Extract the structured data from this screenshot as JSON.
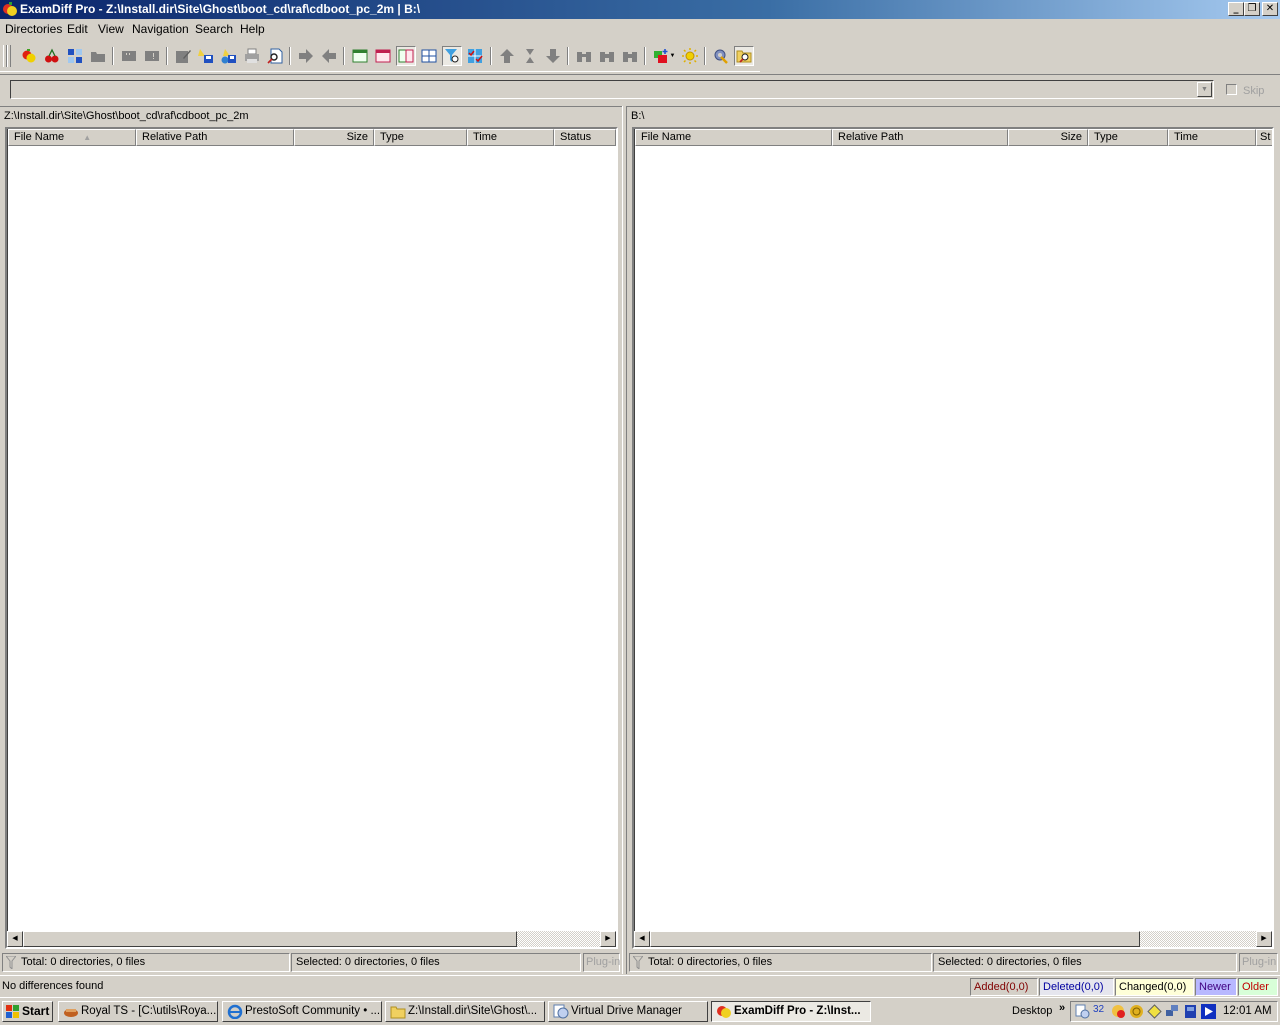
{
  "window": {
    "title": "ExamDiff Pro - Z:\\Install.dir\\Site\\Ghost\\boot_cd\\raf\\cdboot_pc_2m  |  B:\\",
    "controls": {
      "minimize": "_",
      "restore": "❐",
      "close": "✕"
    }
  },
  "menu": [
    "Directories",
    "Edit",
    "View",
    "Navigation",
    "Search",
    "Help"
  ],
  "toolbar": {
    "buttons": [
      {
        "name": "open-directories-icon"
      },
      {
        "name": "compare-cherries-icon"
      },
      {
        "name": "swap-panes-icon"
      },
      {
        "name": "open-folder-icon"
      },
      {
        "name": "comment-icon"
      },
      {
        "name": "alert-icon"
      },
      {
        "name": "edit-icon"
      },
      {
        "name": "save-left-icon"
      },
      {
        "name": "save-web-icon"
      },
      {
        "name": "print-icon"
      },
      {
        "name": "print-preview-icon"
      },
      {
        "name": "copy-right-arrow-icon"
      },
      {
        "name": "copy-left-arrow-icon"
      },
      {
        "name": "left-pane-only-icon"
      },
      {
        "name": "right-pane-only-icon"
      },
      {
        "name": "side-by-side-icon"
      },
      {
        "name": "grid-view-icon"
      },
      {
        "name": "filter-icon"
      },
      {
        "name": "checked-grid-icon"
      },
      {
        "name": "prev-diff-icon"
      },
      {
        "name": "current-diff-icon"
      },
      {
        "name": "next-diff-icon"
      },
      {
        "name": "find-icon"
      },
      {
        "name": "find-next-icon"
      },
      {
        "name": "find-prev-icon"
      },
      {
        "name": "add-plugin-icon"
      },
      {
        "name": "highlight-sun-icon"
      },
      {
        "name": "options-icon"
      },
      {
        "name": "browse-folder-icon"
      }
    ]
  },
  "filter": {
    "value": "",
    "skip_label": "Skip",
    "skip_checked": false
  },
  "left_pane": {
    "path": "Z:\\Install.dir\\Site\\Ghost\\boot_cd\\raf\\cdboot_pc_2m",
    "columns": [
      "File Name",
      "Relative Path",
      "Size",
      "Type",
      "Time",
      "Status"
    ],
    "sort_indicator": "▲",
    "rows": [],
    "status_total": "Total: 0 directories, 0 files",
    "status_selected": "Selected: 0 directories, 0 files",
    "plugin_label": "Plug-in"
  },
  "right_pane": {
    "path": "B:\\",
    "columns": [
      "File Name",
      "Relative Path",
      "Size",
      "Type",
      "Time",
      "St"
    ],
    "rows": [],
    "status_total": "Total: 0 directories, 0 files",
    "status_selected": "Selected: 0 directories, 0 files",
    "plugin_label": "Plug-in"
  },
  "status": {
    "message": "No differences found",
    "legend": [
      {
        "label": "Added(0,0)",
        "color": "#800000",
        "bg": "#d4d0c8"
      },
      {
        "label": "Deleted(0,0)",
        "color": "#0000a0",
        "bg": "#e6e6ee"
      },
      {
        "label": "Changed(0,0)",
        "color": "#000000",
        "bg": "#ffffd8"
      },
      {
        "label": "Newer",
        "color": "#400080",
        "bg": "#b8b8ff"
      },
      {
        "label": "Older",
        "color": "#c00000",
        "bg": "#d8ffd8"
      }
    ]
  },
  "taskbar": {
    "start_label": "Start",
    "tasks": [
      {
        "label": "Royal TS - [C:\\utils\\Roya...",
        "active": false
      },
      {
        "label": "PrestoSoft Community • ...",
        "active": false
      },
      {
        "label": "Z:\\Install.dir\\Site\\Ghost\\...",
        "active": false
      },
      {
        "label": "Virtual Drive Manager",
        "active": false
      },
      {
        "label": "ExamDiff Pro - Z:\\Inst...",
        "active": true
      }
    ],
    "desktop_label": "Desktop",
    "chevron": "»",
    "clock": "12:01 AM"
  }
}
